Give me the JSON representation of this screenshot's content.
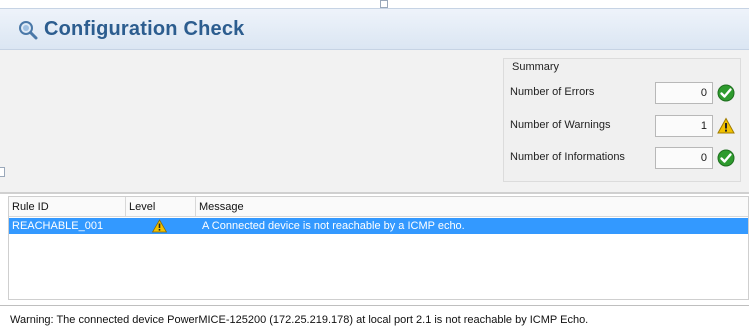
{
  "header": {
    "title": "Configuration Check",
    "icon": "config-check-icon"
  },
  "summary": {
    "title": "Summary",
    "rows": [
      {
        "label": "Number of Errors",
        "value": "0",
        "icon": "check-icon",
        "color": "#2e9b2e"
      },
      {
        "label": "Number of Warnings",
        "value": "1",
        "icon": "warning-icon",
        "color": "#f2c200"
      },
      {
        "label": "Number of Informations",
        "value": "0",
        "icon": "check-icon",
        "color": "#2e9b2e"
      }
    ]
  },
  "table": {
    "columns": [
      "Rule ID",
      "Level",
      "Message"
    ],
    "rows": [
      {
        "rule_id": "REACHABLE_001",
        "level_icon": "warning-icon",
        "message": "A Connected device is not reachable by a ICMP echo.",
        "selected": true
      }
    ],
    "selection_color": "#3399ff"
  },
  "status": {
    "text": "Warning: The connected device PowerMICE-125200 (172.25.219.178) at local port 2.1 is not reachable by ICMP Echo."
  }
}
